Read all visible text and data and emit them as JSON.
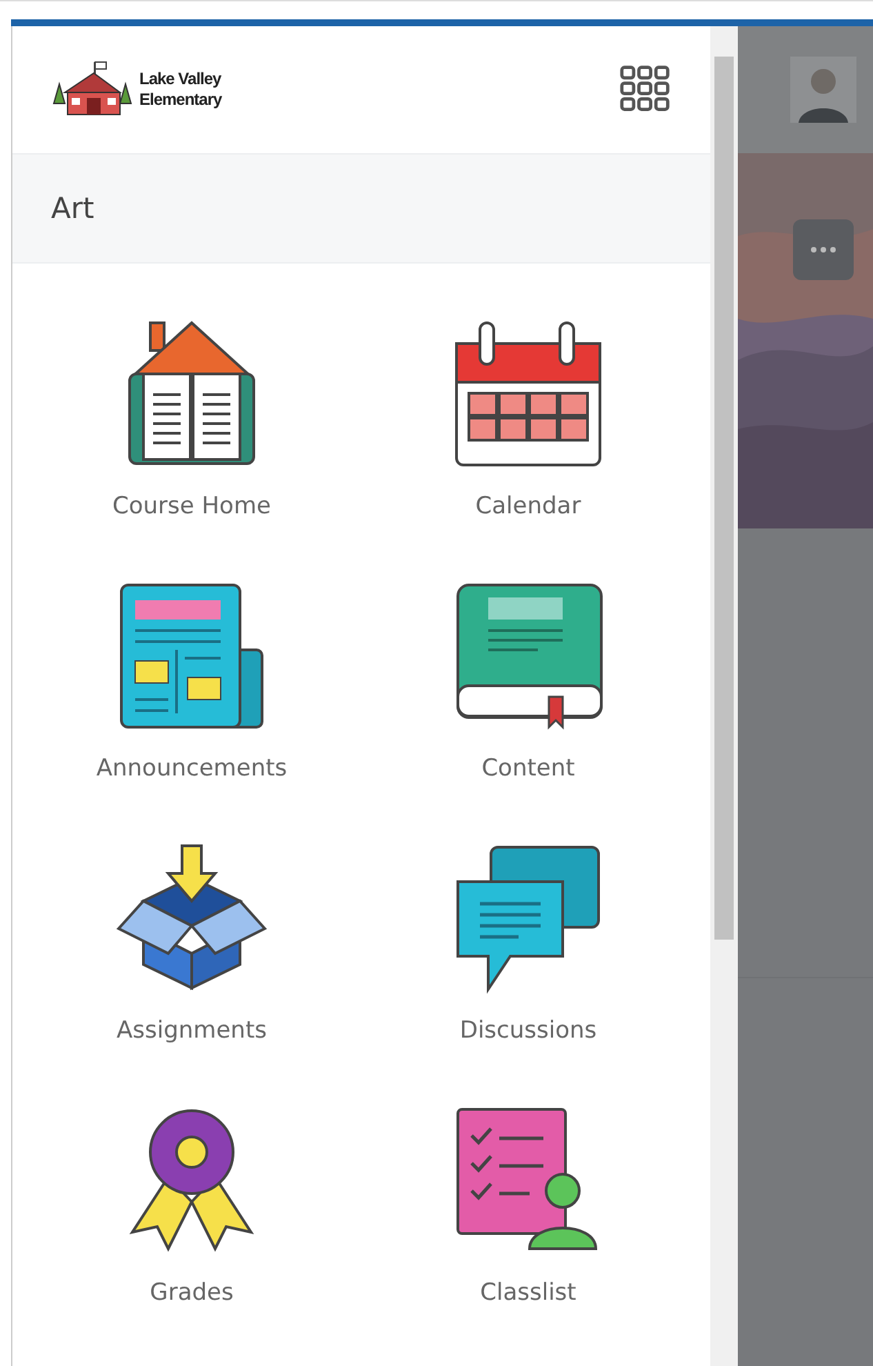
{
  "school_logo": {
    "lines": [
      "Lake Valley",
      "Elementary"
    ]
  },
  "course": {
    "title": "Art"
  },
  "nav_items": [
    {
      "label": "Course Home",
      "kind": "home"
    },
    {
      "label": "Calendar",
      "kind": "calendar"
    },
    {
      "label": "Announcements",
      "kind": "news"
    },
    {
      "label": "Content",
      "kind": "book"
    },
    {
      "label": "Assignments",
      "kind": "box"
    },
    {
      "label": "Discussions",
      "kind": "chat"
    },
    {
      "label": "Grades",
      "kind": "award"
    },
    {
      "label": "Classlist",
      "kind": "list"
    }
  ]
}
